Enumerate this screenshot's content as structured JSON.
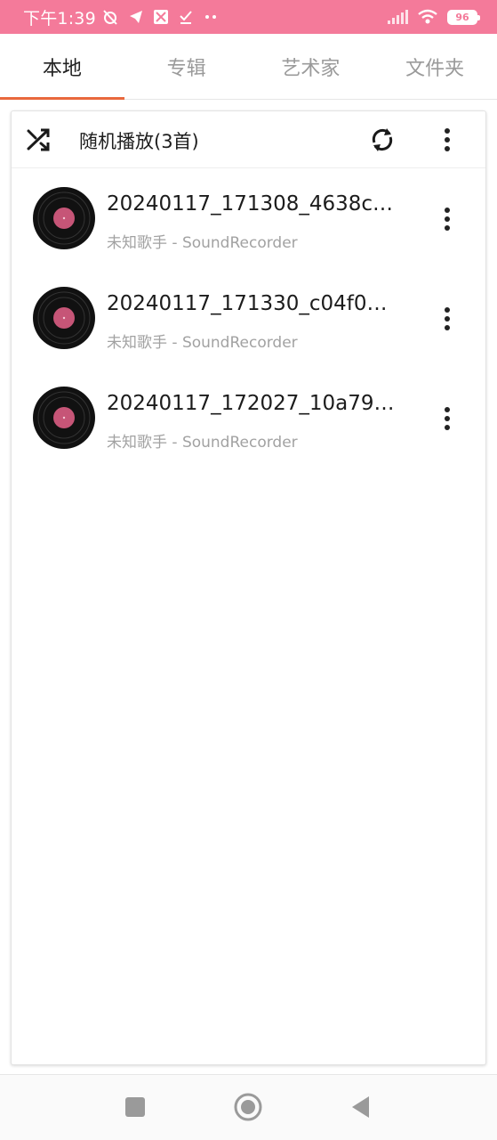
{
  "status_bar": {
    "time": "下午1:39",
    "battery": "96",
    "icons": [
      "alarm-off-icon",
      "telegram-icon",
      "app-icon",
      "download-done-icon",
      "more-dots-icon",
      "signal-icon",
      "wifi-icon",
      "battery-icon"
    ],
    "color": "#f47a9a"
  },
  "tabs": [
    {
      "label": "本地",
      "active": true
    },
    {
      "label": "专辑",
      "active": false
    },
    {
      "label": "艺术家",
      "active": false
    },
    {
      "label": "文件夹",
      "active": false
    }
  ],
  "accent_color": "#e9683d",
  "header": {
    "shuffle_label": "随机播放(3首)",
    "icons": [
      "shuffle-icon",
      "refresh-icon",
      "more-vert-icon"
    ]
  },
  "tracks": [
    {
      "title": "20240117_171308_4638c1...",
      "subtitle": "未知歌手 - SoundRecorder"
    },
    {
      "title": "20240117_171330_c04f067...",
      "subtitle": "未知歌手 - SoundRecorder"
    },
    {
      "title": "20240117_172027_10a792...",
      "subtitle": "未知歌手 - SoundRecorder"
    }
  ],
  "nav": {
    "icons": [
      "recents-square-icon",
      "home-circle-icon",
      "back-triangle-icon"
    ]
  }
}
